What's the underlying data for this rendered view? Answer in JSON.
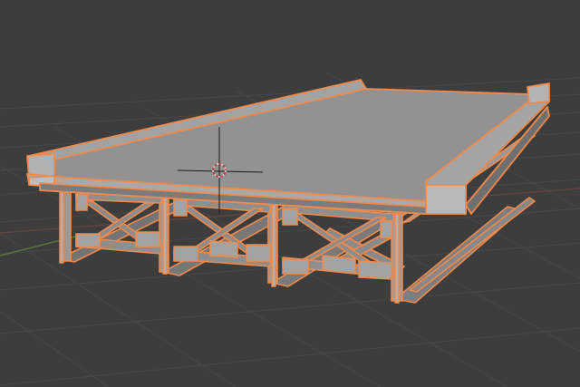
{
  "viewport": {
    "kind": "3d-viewport",
    "colors": {
      "background": "#3d3d3d",
      "grid": "#474747",
      "x_axis": "#8b4a4a",
      "y_axis": "#5f7d33",
      "selection_outline": "#f08a4b",
      "deck_top": "#929292",
      "deck_side": "#9f9f9f",
      "deck_underside": "#6f6f6f",
      "steel": "#8c8c8c",
      "steel_dark": "#5e5e5e",
      "cursor_crosshair": "#1a1a1a",
      "cursor_ring": "#d0d0d0"
    },
    "objects": [
      {
        "name": "bridge-deck",
        "selected": true
      },
      {
        "name": "steel-girder-frame",
        "selected": true
      }
    ],
    "cursor": {
      "icon": "3d-cursor-icon"
    }
  }
}
